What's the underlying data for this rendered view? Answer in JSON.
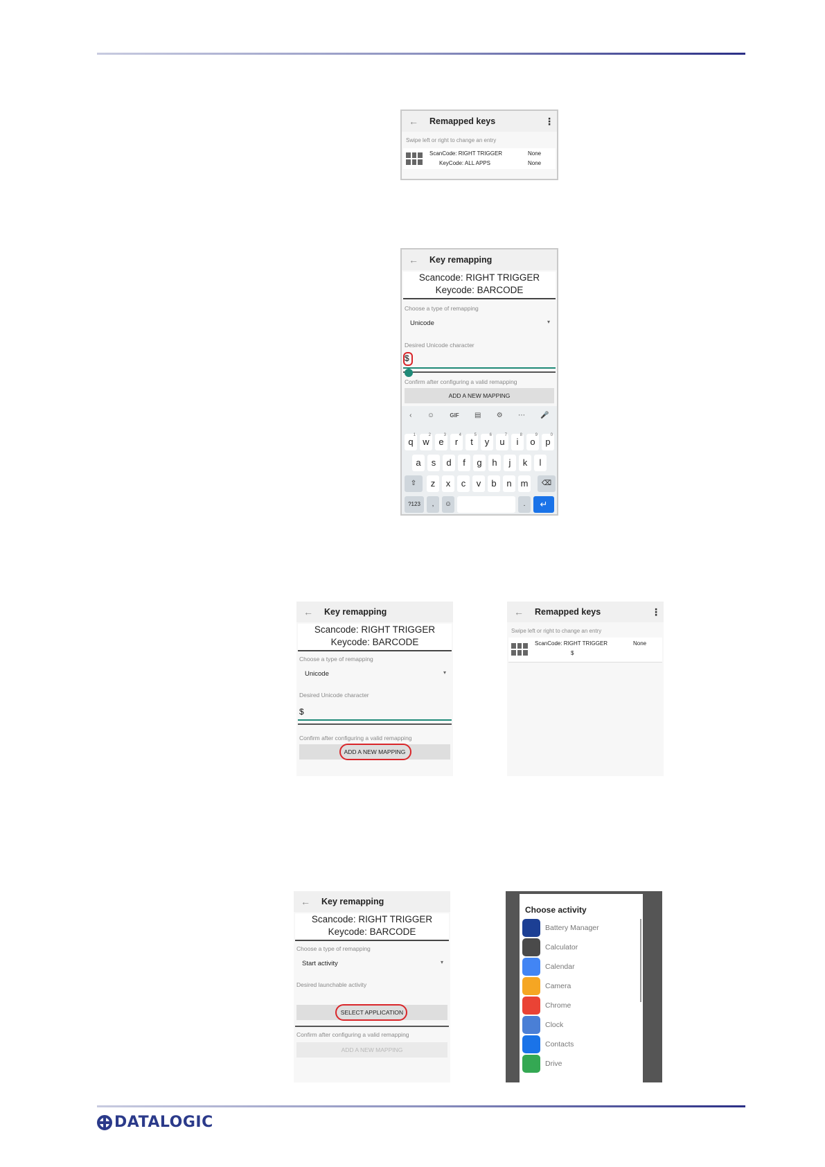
{
  "brand": {
    "logo_text": "DATALOGIC",
    "color": "#2b3a8a"
  },
  "screen1": {
    "title": "Remapped keys",
    "hint": "Swipe left or right to change an entry",
    "entry": {
      "scancode": "ScanCode: RIGHT TRIGGER",
      "keycode": "KeyCode: ALL APPS",
      "status1": "None",
      "status2": "None"
    }
  },
  "screen2": {
    "title": "Key remapping",
    "scancode": "Scancode: RIGHT TRIGGER",
    "keycode": "Keycode: BARCODE",
    "type_label": "Choose a type of remapping",
    "type_value": "Unicode",
    "char_label": "Desired Unicode character",
    "char_value": "$",
    "confirm_label": "Confirm after configuring a valid remapping",
    "button": "ADD A NEW MAPPING",
    "keyboard": {
      "row1": [
        "q",
        "w",
        "e",
        "r",
        "t",
        "y",
        "u",
        "i",
        "o",
        "p"
      ],
      "row1_nums": [
        "1",
        "2",
        "3",
        "4",
        "5",
        "6",
        "7",
        "8",
        "9",
        "0"
      ],
      "row2": [
        "a",
        "s",
        "d",
        "f",
        "g",
        "h",
        "j",
        "k",
        "l"
      ],
      "row3": [
        "z",
        "x",
        "c",
        "v",
        "b",
        "n",
        "m"
      ],
      "toolbar_gif": "GIF",
      "symbols": "?123",
      "comma": ",",
      "period": "."
    }
  },
  "screen3": {
    "title": "Key remapping",
    "scancode": "Scancode: RIGHT TRIGGER",
    "keycode": "Keycode: BARCODE",
    "type_label": "Choose a type of remapping",
    "type_value": "Unicode",
    "char_label": "Desired Unicode character",
    "char_value": "$",
    "confirm_label": "Confirm after configuring a valid remapping",
    "button": "ADD A NEW MAPPING"
  },
  "screen4": {
    "title": "Remapped keys",
    "hint": "Swipe left or right to change an entry",
    "entry": {
      "scancode": "ScanCode: RIGHT TRIGGER",
      "value": "$",
      "status": "None"
    }
  },
  "screen5": {
    "title": "Key remapping",
    "scancode": "Scancode: RIGHT TRIGGER",
    "keycode": "Keycode: BARCODE",
    "type_label": "Choose a type of remapping",
    "type_value": "Start activity",
    "activity_label": "Desired launchable activity",
    "select_button": "SELECT APPLICATION",
    "confirm_label": "Confirm after configuring a valid remapping",
    "add_button": "ADD A NEW MAPPING"
  },
  "screen6": {
    "title": "Choose activity",
    "apps": [
      {
        "name": "Battery Manager",
        "icon": "battery-manager-icon",
        "color": "#1c3f94"
      },
      {
        "name": "Calculator",
        "icon": "calculator-icon",
        "color": "#4a4a4a"
      },
      {
        "name": "Calendar",
        "icon": "calendar-icon",
        "color": "#4285f4"
      },
      {
        "name": "Camera",
        "icon": "camera-icon",
        "color": "#f5a623"
      },
      {
        "name": "Chrome",
        "icon": "chrome-icon",
        "color": "#ea4335"
      },
      {
        "name": "Clock",
        "icon": "clock-icon",
        "color": "#4a7fd6"
      },
      {
        "name": "Contacts",
        "icon": "contacts-icon",
        "color": "#1a73e8"
      },
      {
        "name": "Drive",
        "icon": "drive-icon",
        "color": "#34a853"
      }
    ]
  }
}
